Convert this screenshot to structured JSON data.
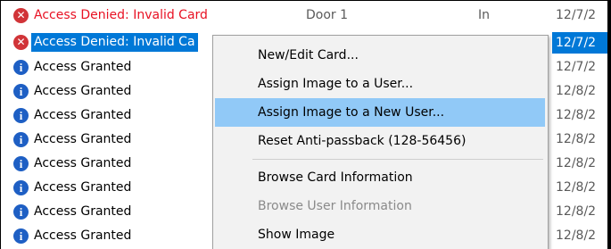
{
  "rows": [
    {
      "message": "Access Denied: Invalid Card",
      "door": "Door 1",
      "direction": "In",
      "date": "12/7/2",
      "type": "error"
    },
    {
      "message": "Access Denied: Invalid Ca",
      "date": "12/7/2",
      "type": "error"
    },
    {
      "message": "Access Granted",
      "date": "12/7/2",
      "type": "info"
    },
    {
      "message": "Access Granted",
      "date": "12/8/2",
      "type": "info"
    },
    {
      "message": "Access Granted",
      "date": "12/8/2",
      "type": "info"
    },
    {
      "message": "Access Granted",
      "date": "12/8/2",
      "type": "info"
    },
    {
      "message": "Access Granted",
      "date": "12/8/2",
      "type": "info"
    },
    {
      "message": "Access Granted",
      "date": "12/8/2",
      "type": "info"
    },
    {
      "message": "Access Granted",
      "date": "12/8/2",
      "type": "info"
    },
    {
      "message": "Access Granted",
      "date": "12/8/2",
      "type": "info"
    }
  ],
  "context_menu": {
    "items": [
      {
        "label": "New/Edit Card...",
        "state": "normal"
      },
      {
        "label": "Assign Image to a User...",
        "state": "normal"
      },
      {
        "label": "Assign Image to a New User...",
        "state": "highlighted"
      },
      {
        "label": "Reset Anti-passback (128-56456)",
        "state": "normal"
      },
      {
        "label": "Browse Card Information",
        "state": "normal"
      },
      {
        "label": "Browse User Information",
        "state": "disabled"
      },
      {
        "label": "Show Image",
        "state": "normal"
      }
    ]
  },
  "colors": {
    "selection": "#0078d7",
    "menu_highlight": "#91c9f7",
    "denied_text": "#e81123",
    "error_icon": "#d13438",
    "info_icon": "#1e5fc4",
    "menu_background": "#f2f2f2"
  },
  "icons": {
    "error": "error-icon",
    "info": "info-icon"
  }
}
